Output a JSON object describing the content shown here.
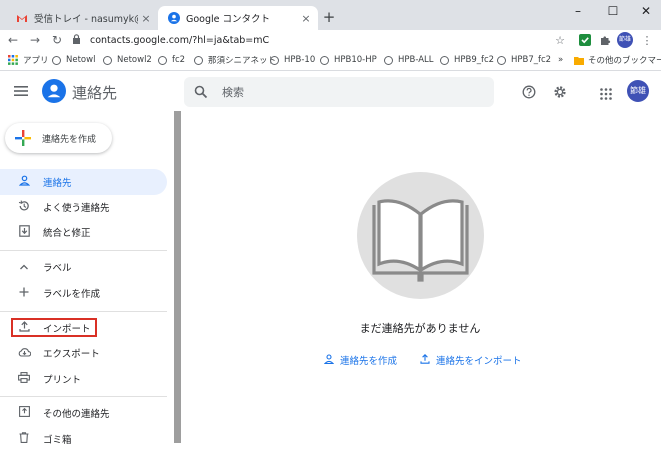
{
  "tabs": [
    {
      "title": "受信トレイ - nasumyk@gmail.com",
      "close": "×"
    },
    {
      "title": "Google コンタクト",
      "close": "×"
    }
  ],
  "new_tab": "+",
  "window": {
    "minimize": "–",
    "maximize": "☐",
    "close": "✕"
  },
  "url": "contacts.google.com/?hl=ja&tab=mC",
  "profile_label": "節雄",
  "bookmarks": {
    "apps": "アプリ",
    "items": [
      "Netowl",
      "Netowl2",
      "fc2",
      "那須シニアネット",
      "HPB-10",
      "HPB10-HP",
      "HPB-ALL",
      "HPB9_fc2",
      "HPB7_fc2"
    ],
    "more": "»",
    "other": "その他のブックマーク"
  },
  "app": {
    "title": "連絡先",
    "search_placeholder": "検索",
    "avatar_label": "節雄"
  },
  "sidebar": {
    "create_label": "連絡先を作成",
    "items": [
      {
        "label": "連絡先",
        "icon": "person-icon"
      },
      {
        "label": "よく使う連絡先",
        "icon": "history-icon"
      },
      {
        "label": "統合と修正",
        "icon": "merge-icon"
      },
      {
        "label": "ラベル",
        "icon": "chevron-up-icon"
      },
      {
        "label": "ラベルを作成",
        "icon": "plus-icon"
      },
      {
        "label": "インポート",
        "icon": "upload-icon"
      },
      {
        "label": "エクスポート",
        "icon": "cloud-download-icon"
      },
      {
        "label": "プリント",
        "icon": "print-icon"
      },
      {
        "label": "その他の連絡先",
        "icon": "other-contacts-icon"
      },
      {
        "label": "ゴミ箱",
        "icon": "trash-icon"
      }
    ]
  },
  "main": {
    "empty_message": "まだ連絡先がありません",
    "create_link": "連絡先を作成",
    "import_link": "連絡先をインポート"
  },
  "colors": {
    "accent": "#1a73e8",
    "highlight": "#d93025",
    "avatar": "#3f51b5"
  }
}
